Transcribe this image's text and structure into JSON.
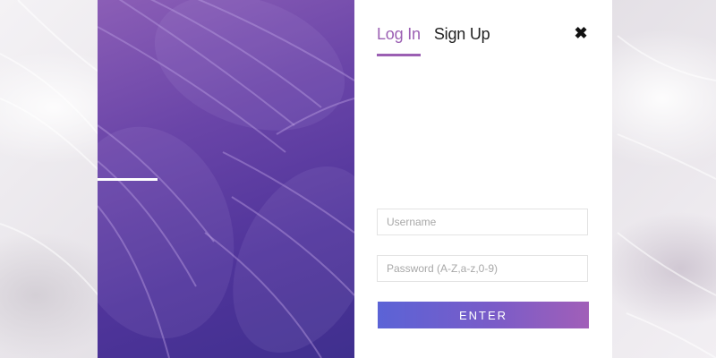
{
  "auth": {
    "tabs": [
      {
        "label": "Log In",
        "active": true
      },
      {
        "label": "Sign Up",
        "active": false
      }
    ],
    "close_symbol": "✖",
    "username": {
      "placeholder": "Username",
      "value": ""
    },
    "password": {
      "placeholder": "Password (A-Z,a-z,0-9)",
      "value": ""
    },
    "enter_label": "ENTER"
  },
  "colors": {
    "accent": "#9b5fb3",
    "button_gradient_start": "#5b63d6",
    "button_gradient_end": "#a15fb8",
    "image_tint": "#5e3fa3"
  },
  "icons": {
    "close": "close-icon"
  }
}
